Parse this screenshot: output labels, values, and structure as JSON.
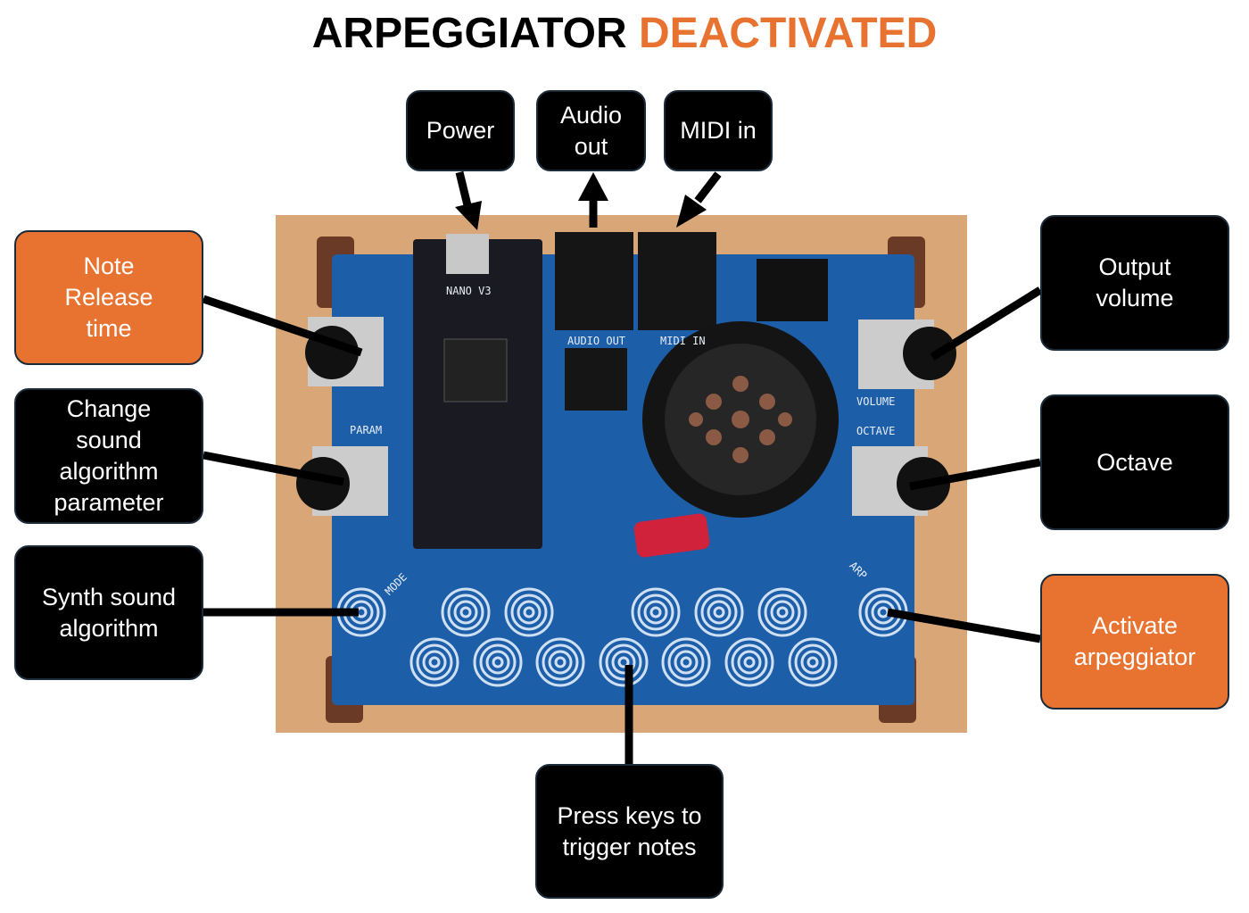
{
  "title": {
    "prefix": "ARPEGGIATOR",
    "status": "DEACTIVATED",
    "status_color": "#e8722f"
  },
  "labels": {
    "power": "Power",
    "audio_out": "Audio out",
    "midi_in": "MIDI in",
    "note_release": "Note Release time",
    "change_param": "Change sound algorithm parameter",
    "synth_algo": "Synth sound algorithm",
    "output_volume": "Output volume",
    "octave": "Octave",
    "activate_arp": "Activate arpeggiator",
    "press_keys": "Press keys to trigger notes"
  },
  "board": {
    "nano": "NANO V3",
    "param": "PARAM",
    "volume": "VOLUME",
    "octave": "OCTAVE",
    "mode": "MODE",
    "arp": "ARP",
    "audio": "AUDIO OUT",
    "midi": "MIDI IN"
  },
  "colors": {
    "accent": "#e8722f",
    "box": "#000000",
    "pcb": "#1d5ea8",
    "wood": "#d9a678"
  }
}
